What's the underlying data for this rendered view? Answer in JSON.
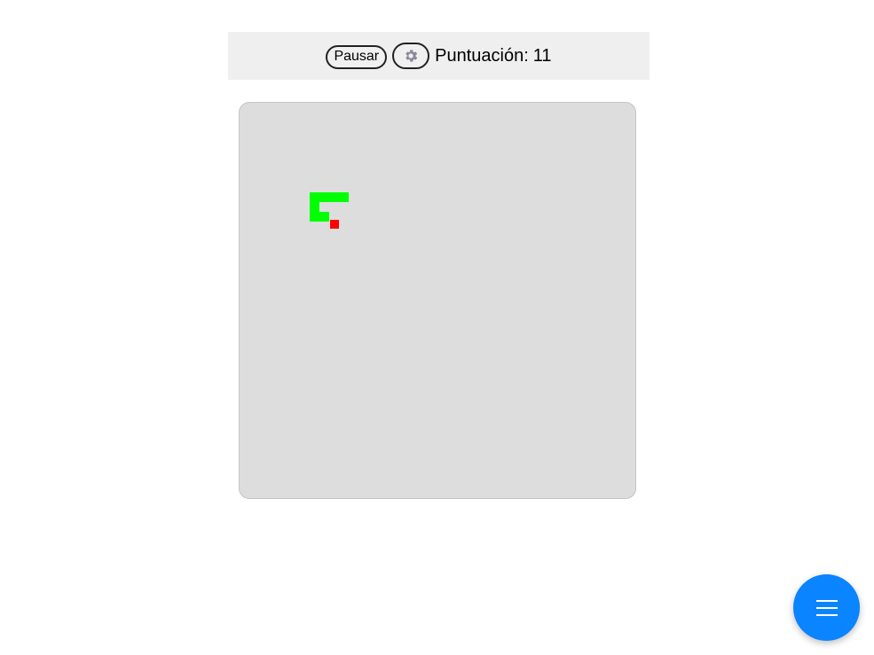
{
  "toolbar": {
    "pause_label": "Pausar",
    "settings_icon": "gear-icon",
    "score_label": "Puntuación:",
    "score_value": "11"
  },
  "game": {
    "snake_color": "#00ff00",
    "food_color": "#ff0000",
    "board_color": "#dddddd",
    "snake_cells": [
      [
        10,
        9
      ],
      [
        9,
        9
      ],
      [
        8,
        9
      ],
      [
        7,
        9
      ],
      [
        7,
        10
      ],
      [
        7,
        11
      ],
      [
        8,
        11
      ]
    ],
    "food_cell": [
      9,
      12
    ]
  },
  "menu_fab": {
    "icon": "menu-icon",
    "color": "#0a84ff"
  }
}
